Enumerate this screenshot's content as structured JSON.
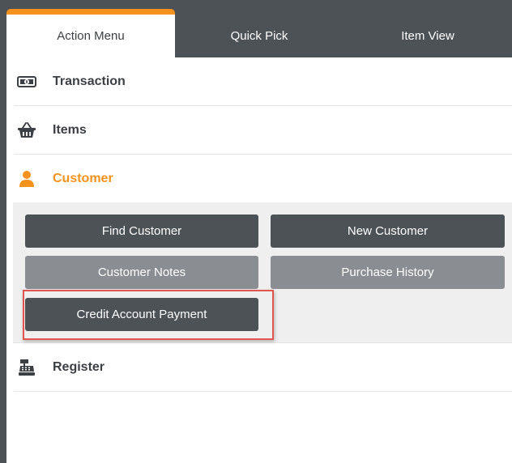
{
  "tabs": [
    {
      "label": "Action Menu"
    },
    {
      "label": "Quick Pick"
    },
    {
      "label": "Item View"
    }
  ],
  "menu": {
    "transaction": {
      "label": "Transaction",
      "icon": "money-icon"
    },
    "items": {
      "label": "Items",
      "icon": "basket-icon"
    },
    "customer": {
      "label": "Customer",
      "icon": "person-icon"
    },
    "register": {
      "label": "Register",
      "icon": "cash-register-icon"
    }
  },
  "customer_actions": {
    "find_customer": "Find Customer",
    "new_customer": "New Customer",
    "customer_notes": "Customer Notes",
    "purchase_history": "Purchase History",
    "credit_account_payment": "Credit Account Payment"
  },
  "colors": {
    "accent": "#f5921e",
    "dark": "#4d5257",
    "button_dark": "#4d5257",
    "button_light": "#8a8e92",
    "highlight": "#e0554c"
  }
}
